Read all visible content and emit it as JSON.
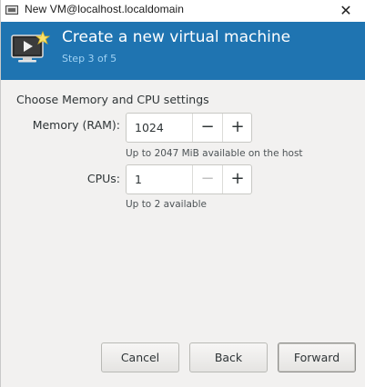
{
  "window": {
    "title": "New VM@localhost.localdomain",
    "close_glyph": "✕"
  },
  "header": {
    "icon": "virtual-machine-icon",
    "title": "Create a new virtual machine",
    "step": "Step 3 of 5"
  },
  "section": {
    "title": "Choose Memory and CPU settings"
  },
  "memory": {
    "label": "Memory (RAM):",
    "value": "1024",
    "decrement": "−",
    "increment": "+",
    "hint": "Up to 2047 MiB available on the host"
  },
  "cpus": {
    "label": "CPUs:",
    "value": "1",
    "decrement": "−",
    "increment": "+",
    "hint": "Up to 2 available"
  },
  "buttons": {
    "cancel": "Cancel",
    "back": "Back",
    "forward": "Forward"
  },
  "colors": {
    "header_bg": "#1f74b1",
    "step_text": "#9fd2f4",
    "content_bg": "#f2f1f0"
  }
}
